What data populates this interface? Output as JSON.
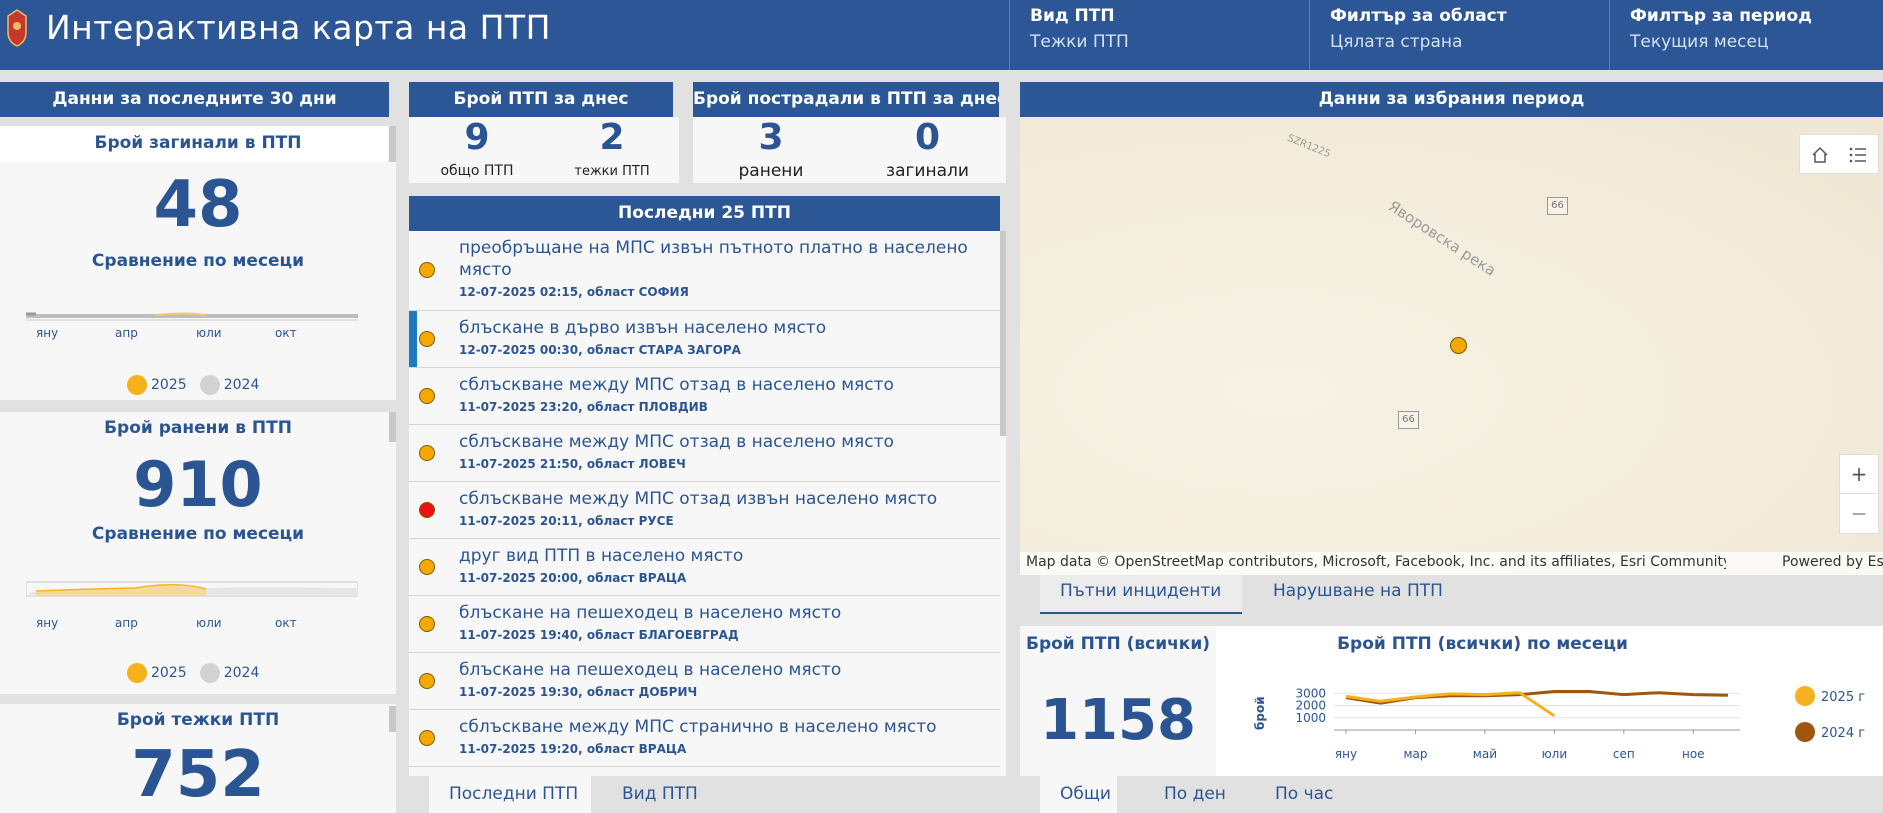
{
  "header": {
    "title": "Интерактивна карта на ПТП",
    "filters": [
      {
        "label": "Вид ПТП",
        "value": "Тежки ПТП"
      },
      {
        "label": "Филтър за област",
        "value": "Цялата страна"
      },
      {
        "label": "Филтър за период",
        "value": "Текущия месец"
      }
    ]
  },
  "left": {
    "header": "Данни за последните 30 дни",
    "cards": [
      {
        "title": "Брой загинали в ПТП",
        "value": "48",
        "compare": "Сравнение по месеци"
      },
      {
        "title": "Брой ранени в ПТП",
        "value": "910",
        "compare": "Сравнение по месеци"
      },
      {
        "title": "Брой тежки ПТП",
        "value": "752"
      }
    ],
    "months": [
      "яну",
      "апр",
      "юли",
      "окт"
    ],
    "legend": {
      "a": "2025",
      "b": "2024",
      "color_a": "#f5b21c",
      "color_b": "#cccccc"
    }
  },
  "today": {
    "header": "Брой ПТП за днес",
    "total": "9",
    "total_label": "общо ПТП",
    "severe": "2",
    "severe_label": "тежки ПТП"
  },
  "injured_today": {
    "header": "Брой пострадали в ПТП за днес",
    "injured": "3",
    "injured_label": "ранени",
    "killed": "0",
    "killed_label": "загинали"
  },
  "recent": {
    "header": "Последни 25 ПТП",
    "items": [
      {
        "title": "преобръщане на МПС извън пътното платно  в населено място",
        "sub": "12-07-2025 02:15, област СОФИЯ",
        "color": "#f5a800"
      },
      {
        "title": "блъскане в дърво  извън населено място",
        "sub": "12-07-2025 00:30, област СТАРА ЗАГОРА",
        "color": "#f5a800"
      },
      {
        "title": "сблъскване между МПС отзад  в населено място",
        "sub": "11-07-2025 23:20, област ПЛОВДИВ",
        "color": "#f5a800"
      },
      {
        "title": "сблъскване между МПС отзад  в населено място",
        "sub": "11-07-2025 21:50, област ЛОВЕЧ",
        "color": "#f5a800"
      },
      {
        "title": "сблъскване между МПС отзад  извън населено място",
        "sub": "11-07-2025 20:11, област РУСЕ",
        "color": "#ee1111"
      },
      {
        "title": "друг вид ПТП  в населено място",
        "sub": "11-07-2025 20:00, област ВРАЦА",
        "color": "#f5a800"
      },
      {
        "title": "блъскане на пешеходец  в населено място",
        "sub": "11-07-2025 19:40, област БЛАГОЕВГРАД",
        "color": "#f5a800"
      },
      {
        "title": "блъскане на пешеходец  в населено място",
        "sub": "11-07-2025 19:30, област ДОБРИЧ",
        "color": "#f5a800"
      },
      {
        "title": "сблъскване между МПС странично  в населено място",
        "sub": "11-07-2025 19:20, област ВРАЦА",
        "color": "#f5a800"
      }
    ],
    "tabs": [
      "Последни ПТП",
      "Вид ПТП"
    ]
  },
  "map": {
    "header": "Данни за избрания период",
    "labels": {
      "road1": "SZR1225",
      "river": "Яворовска река",
      "shield": "66"
    },
    "attribution": "Map data © OpenStreetMap contributors, Microsoft, Facebook, Inc. and its affiliates, Esri Community Maps c...",
    "powered": "Powered by Es",
    "zoom_in": "+",
    "zoom_out": "—",
    "tabs": [
      "Пътни инциденти",
      "Нарушване на ПТП"
    ]
  },
  "bottom": {
    "total_title": "Брой ПТП (всички)",
    "total_value": "1158",
    "chart_title": "Брой ПТП (всички) по месеци",
    "tabs": [
      "Общи",
      "По ден",
      "По час"
    ]
  },
  "chart_data": {
    "type": "line",
    "title": "Брой ПТП (всички) по месеци",
    "ylabel": "брой",
    "yticks": [
      "3000",
      "2000",
      "1000"
    ],
    "ylim": [
      0,
      3600
    ],
    "categories": [
      "яну",
      "фев",
      "мар",
      "апр",
      "май",
      "юни",
      "юли",
      "авг",
      "сеп",
      "окт",
      "ное",
      "дек"
    ],
    "xticks": [
      "яну",
      "мар",
      "май",
      "юли",
      "сеп",
      "ное"
    ],
    "series": [
      {
        "name": "2025 г",
        "color": "#f5b21c",
        "values": [
          2750,
          2350,
          2700,
          2950,
          2900,
          3050,
          1150
        ]
      },
      {
        "name": "2024 г",
        "color": "#a0560f",
        "values": [
          2650,
          2200,
          2650,
          2800,
          2800,
          2900,
          3150,
          3150,
          2900,
          3050,
          2900,
          2850
        ]
      }
    ]
  }
}
